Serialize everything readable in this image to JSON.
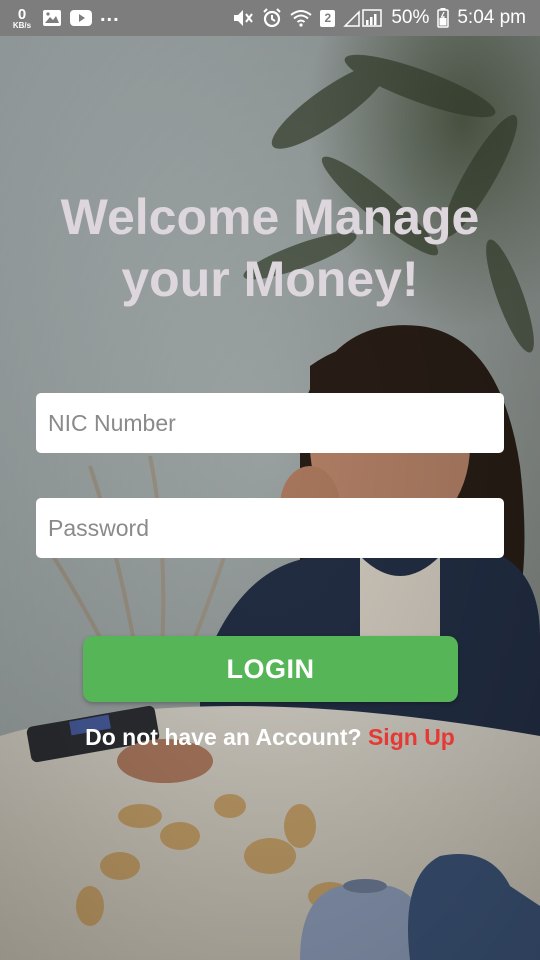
{
  "status_bar": {
    "net_speed_value": "0",
    "net_speed_unit": "KB/s",
    "overflow": "...",
    "sim_number": "2",
    "battery_percent": "50%",
    "time": "5:04 pm"
  },
  "login": {
    "title_line1": "Welcome Manage",
    "title_line2": "your Money!",
    "nic_placeholder": "NIC Number",
    "password_placeholder": "Password",
    "login_button": "LOGIN",
    "no_account_text": "Do not have an Account?",
    "signup_link": "Sign Up"
  },
  "colors": {
    "title": "#ddd6dc",
    "button": "#56b657",
    "signup_link": "#e53935",
    "status_bar": "#7d7d7d"
  }
}
